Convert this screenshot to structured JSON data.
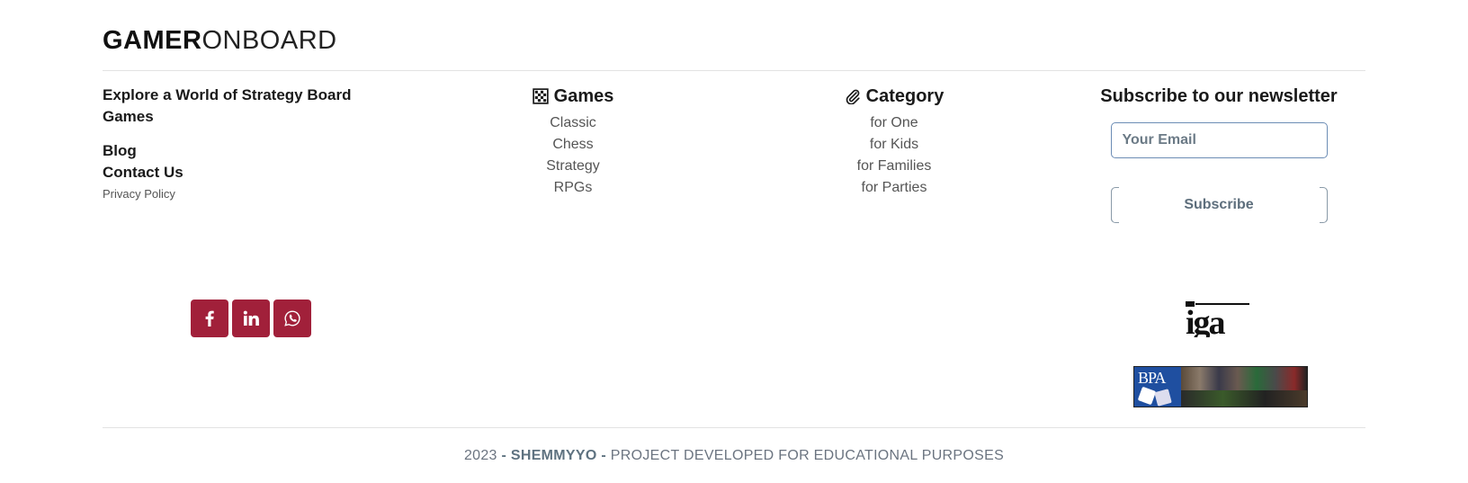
{
  "brand": {
    "bold": "GAMER",
    "light": "ONBOARD"
  },
  "about": {
    "tagline": "Explore a World of Strategy Board Games",
    "links": [
      "Blog",
      "Contact Us"
    ],
    "privacy": "Privacy Policy"
  },
  "games": {
    "title": "Games",
    "icon": "chess-board-icon",
    "items": [
      "Classic",
      "Chess",
      "Strategy",
      "RPGs"
    ]
  },
  "category": {
    "title": "Category",
    "icon": "paperclip-icon",
    "items": [
      "for One",
      "for Kids",
      "for Families",
      "for Parties"
    ]
  },
  "newsletter": {
    "title": "Subscribe to our newsletter",
    "email_placeholder": "Your Email",
    "button_label": "Subscribe"
  },
  "social": {
    "color": "#a1203a",
    "icons": [
      "facebook-icon",
      "linkedin-icon",
      "whatsapp-icon"
    ],
    "labels": [
      "f",
      "in",
      ""
    ]
  },
  "partners": {
    "iga_text": "iga",
    "bpa_text": "BPA"
  },
  "footer": {
    "year": "2023",
    "separator": "-",
    "author": "SHEMMYYO",
    "note": "PROJECT DEVELOPED FOR EDUCATIONAL PURPOSES"
  }
}
